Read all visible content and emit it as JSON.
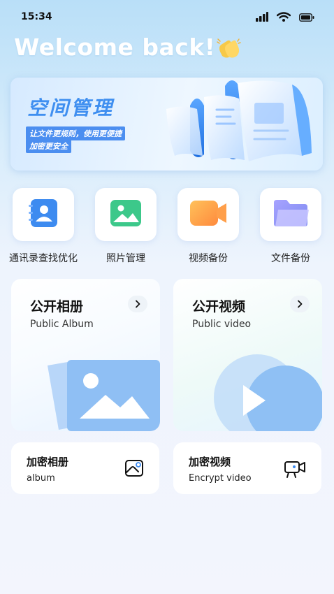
{
  "status_bar": {
    "time": "15:34",
    "icons": [
      "signal-icon",
      "wifi-icon",
      "battery-icon"
    ]
  },
  "header": {
    "welcome": "Welcome back!",
    "icon": "clapping-hands-icon"
  },
  "banner": {
    "title": "空间管理",
    "line1": "让文件更规则，使用更便捷",
    "line2": "加密更安全"
  },
  "quick_actions": [
    {
      "label": "通讯录查找优化",
      "icon": "contacts-icon",
      "color": "#3d8bf0"
    },
    {
      "label": "照片管理",
      "icon": "photo-icon",
      "color": "#3cc88a"
    },
    {
      "label": "视频备份",
      "icon": "video-camera-icon",
      "color": "#ff9f4a"
    },
    {
      "label": "文件备份",
      "icon": "folder-icon",
      "color": "#8f8cf5"
    }
  ],
  "cards": {
    "public_album": {
      "title": "公开相册",
      "subtitle": "Public Album"
    },
    "public_video": {
      "title": "公开视频",
      "subtitle": "Public video"
    },
    "encrypt_album": {
      "title": "加密相册",
      "subtitle": "album"
    },
    "encrypt_video": {
      "title": "加密视频",
      "subtitle": "Encrypt video"
    }
  },
  "colors": {
    "accent": "#3f8ff0",
    "background_top": "#b9dff8",
    "background_bottom": "#f3f5fd"
  }
}
